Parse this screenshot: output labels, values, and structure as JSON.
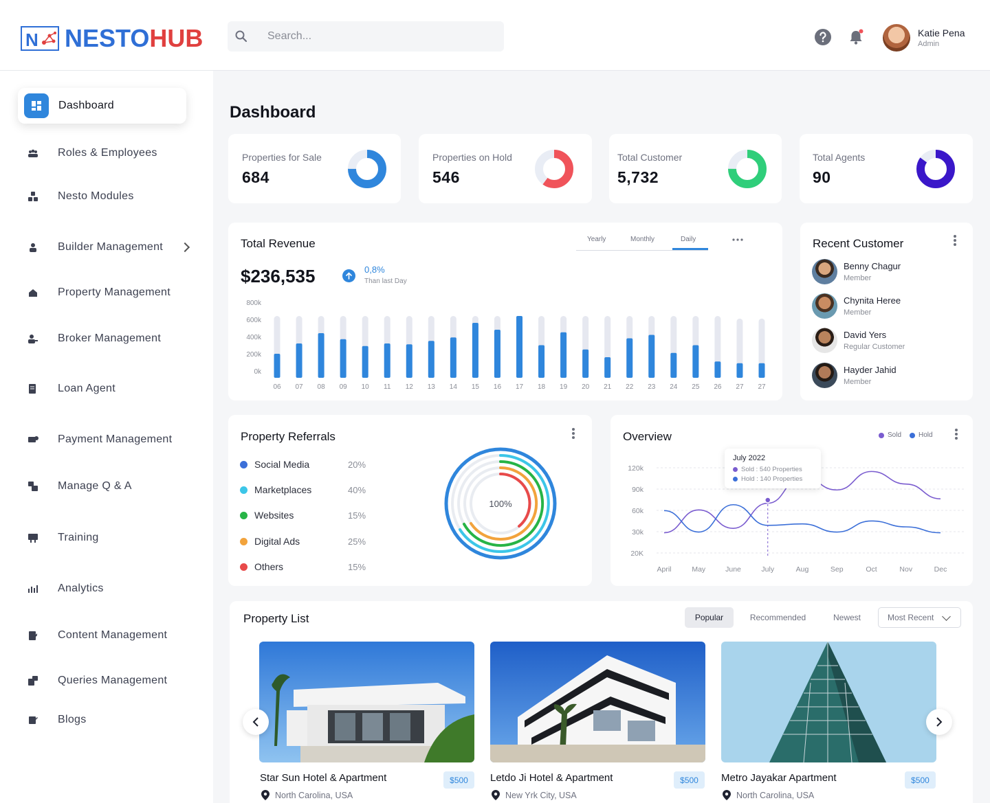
{
  "brand": {
    "name_part1": "NESTO",
    "name_part2": "HUB",
    "mark_letter": "N"
  },
  "search": {
    "placeholder": "Search..."
  },
  "user": {
    "name": "Katie Pena",
    "role": "Admin"
  },
  "colors": {
    "accent": "#2f86dc",
    "brand_blue": "#2f6fd6",
    "brand_red": "#e0403f"
  },
  "sidebar": {
    "items": [
      {
        "label": "Dashboard",
        "icon": "dashboard-icon",
        "active": true
      },
      {
        "label": "Roles & Employees",
        "icon": "people-group-icon"
      },
      {
        "label": "Nesto Modules",
        "icon": "modules-icon"
      },
      {
        "label": "Builder Management",
        "icon": "builder-icon",
        "has_submenu": true
      },
      {
        "label": "Property Management",
        "icon": "property-icon"
      },
      {
        "label": "Broker Management",
        "icon": "broker-icon"
      },
      {
        "label": "Loan Agent",
        "icon": "loan-icon"
      },
      {
        "label": "Payment Management",
        "icon": "payment-icon"
      },
      {
        "label": "Manage Q & A",
        "icon": "qa-icon"
      },
      {
        "label": "Training",
        "icon": "training-icon"
      },
      {
        "label": "Analytics",
        "icon": "analytics-icon"
      },
      {
        "label": "Content Management",
        "icon": "content-icon"
      },
      {
        "label": "Queries Management",
        "icon": "queries-icon"
      },
      {
        "label": "Blogs",
        "icon": "blogs-icon"
      }
    ]
  },
  "page": {
    "title": "Dashboard"
  },
  "stats": [
    {
      "label": "Properties for Sale",
      "value": "684",
      "ring_color": "#2f86dc",
      "fill": 0.75
    },
    {
      "label": "Properties on Hold",
      "value": "546",
      "ring_color": "#f0535a",
      "fill": 0.6
    },
    {
      "label": "Total Customer",
      "value": "5,732",
      "ring_color": "#2fce7a",
      "fill": 0.75
    },
    {
      "label": "Total Agents",
      "value": "90",
      "ring_color": "#3a17c9",
      "fill": 0.85
    }
  ],
  "revenue": {
    "title": "Total Revenue",
    "tabs": [
      "Yearly",
      "Monthly",
      "Daily"
    ],
    "active_tab": "Daily",
    "value": "$236,535",
    "change": "0,8%",
    "change_sub": "Than last Day"
  },
  "chart_data": [
    {
      "type": "bar",
      "title": "Total Revenue",
      "categories": [
        "06",
        "07",
        "08",
        "09",
        "10",
        "11",
        "12",
        "13",
        "14",
        "15",
        "16",
        "17",
        "18",
        "19",
        "20",
        "21",
        "22",
        "23",
        "24",
        "25",
        "26",
        "27",
        "27"
      ],
      "series": [
        {
          "values": [
            280,
            400,
            520,
            450,
            370,
            400,
            390,
            430,
            470,
            640,
            560,
            720,
            380,
            530,
            330,
            240,
            460,
            500,
            290,
            380,
            190,
            170,
            170
          ]
        }
      ],
      "max_values": [
        720,
        720,
        720,
        720,
        720,
        720,
        720,
        720,
        720,
        720,
        720,
        720,
        720,
        720,
        720,
        720,
        720,
        720,
        720,
        720,
        720,
        690,
        690
      ],
      "yticks": [
        "800k",
        "600k",
        "400k",
        "200k",
        "0k"
      ],
      "ylim": [
        0,
        800
      ],
      "colors": {
        "bar": "#2f86dc",
        "track": "#e6e8f0"
      }
    },
    {
      "type": "line",
      "title": "Overview",
      "x": [
        "April",
        "May",
        "June",
        "July",
        "Aug",
        "Sep",
        "Oct",
        "Nov",
        "Dec"
      ],
      "yticks": [
        "120k",
        "90k",
        "60k",
        "30k",
        "20K"
      ],
      "series": [
        {
          "name": "Sold",
          "color": "#7a5ccf",
          "values": [
            32,
            63,
            38,
            72,
            108,
            90,
            115,
            98,
            78
          ]
        },
        {
          "name": "Hold",
          "color": "#3b6fd8",
          "values": [
            62,
            33,
            70,
            42,
            44,
            33,
            48,
            40,
            32
          ]
        }
      ],
      "tooltip": {
        "title": "July 2022",
        "sold": "Sold : 540 Properties",
        "hold": "Hold : 140 Properties"
      }
    }
  ],
  "recent_customers": {
    "title": "Recent Customer",
    "items": [
      {
        "name": "Benny Chagur",
        "role": "Member"
      },
      {
        "name": "Chynita Heree",
        "role": "Member"
      },
      {
        "name": "David Yers",
        "role": "Regular Customer"
      },
      {
        "name": "Hayder Jahid",
        "role": "Member"
      }
    ]
  },
  "referrals": {
    "title": "Property Referrals",
    "center_label": "100%",
    "items": [
      {
        "label": "Social Media",
        "pct": "20%",
        "color": "#3b6fd8"
      },
      {
        "label": "Marketplaces",
        "pct": "40%",
        "color": "#3cc6e8"
      },
      {
        "label": "Websites",
        "pct": "15%",
        "color": "#27b446"
      },
      {
        "label": "Digital Ads",
        "pct": "25%",
        "color": "#f2a33c"
      },
      {
        "label": "Others",
        "pct": "15%",
        "color": "#e84a4a"
      }
    ]
  },
  "overview": {
    "title": "Overview",
    "legend_sold": "Sold",
    "legend_hold": "Hold"
  },
  "property_list": {
    "title": "Property List",
    "filters": [
      "Popular",
      "Recommended",
      "Newest"
    ],
    "sort": "Most Recent",
    "items": [
      {
        "name": "Star Sun Hotel & Apartment",
        "location": "North Carolina, USA",
        "price": "$500"
      },
      {
        "name": "Letdo Ji Hotel & Apartment",
        "location": "New Yrk City, USA",
        "price": "$500"
      },
      {
        "name": "Metro Jayakar Apartment",
        "location": "North Carolina, USA",
        "price": "$500"
      }
    ]
  }
}
